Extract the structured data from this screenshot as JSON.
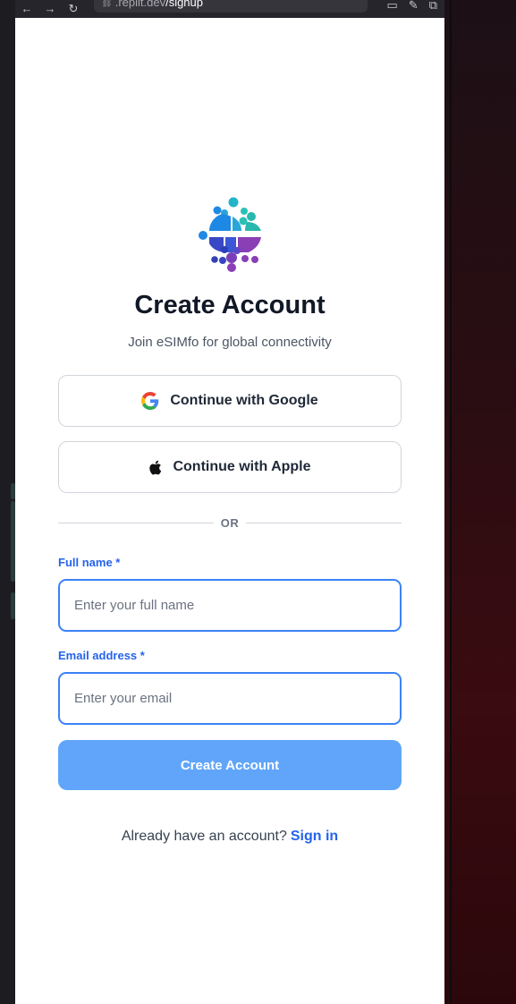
{
  "browser": {
    "back_icon": "arrow-left-icon",
    "forward_icon": "arrow-right-icon",
    "reload_icon": "reload-icon",
    "url_host": ".replit.dev",
    "url_path": "/signup"
  },
  "signup": {
    "logo": "esimfo-globe-logo",
    "title": "Create Account",
    "subtitle": "Join eSIMfo for global connectivity",
    "google_label": "Continue with Google",
    "apple_label": "Continue with Apple",
    "divider_text": "OR",
    "fullname_label": "Full name *",
    "fullname_placeholder": "Enter your full name",
    "email_label": "Email address *",
    "email_placeholder": "Enter your email",
    "submit_label": "Create Account",
    "signin_prompt": "Already have an account?",
    "signin_link": "Sign in"
  },
  "colors": {
    "primary": "#2563eb",
    "primary_light": "#60a5fa",
    "title": "#111827"
  }
}
